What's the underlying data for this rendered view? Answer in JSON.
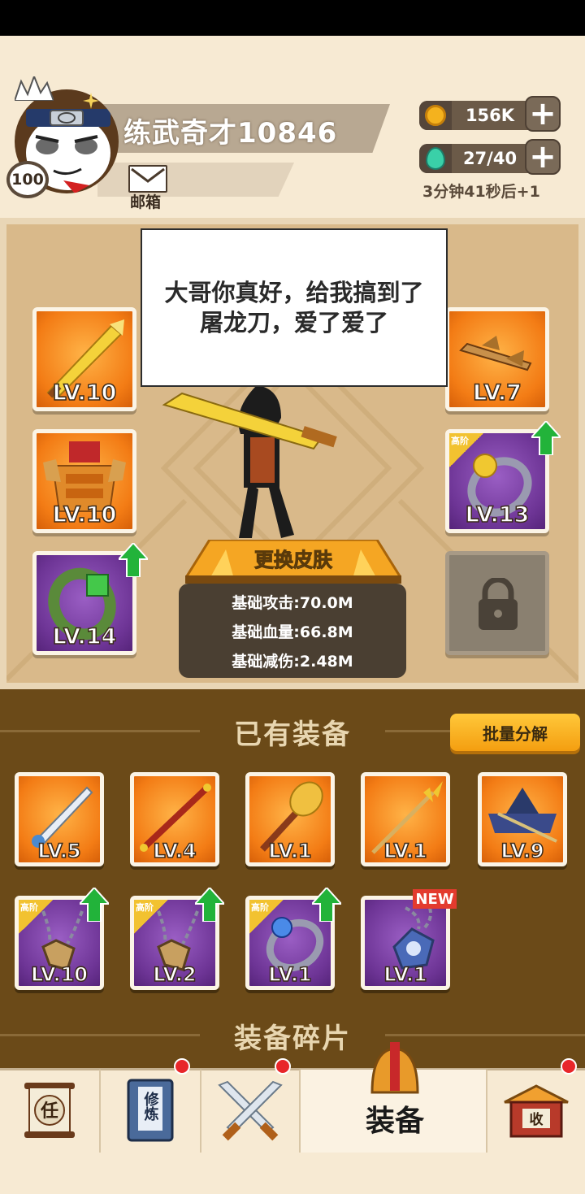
{
  "player": {
    "name": "练武奇才10846",
    "level": "100",
    "mail_label": "邮箱"
  },
  "resources": {
    "coins": "156K",
    "energy": "27/40",
    "timer": "3分钟41秒后+1"
  },
  "speech": "大哥你真好，给我搞到了屠龙刀，爱了爱了",
  "equipped": {
    "left": [
      {
        "label": "LV.10",
        "rarity": "orange",
        "icon": "golden-saber-icon"
      },
      {
        "label": "LV.10",
        "rarity": "orange",
        "icon": "armor-icon"
      },
      {
        "label": "LV.14",
        "rarity": "purple",
        "icon": "jade-bracelet-icon",
        "upgrade": true
      }
    ],
    "right": [
      {
        "label": "LV.7",
        "rarity": "orange",
        "icon": "dragon-hairpin-icon"
      },
      {
        "label": "LV.13",
        "rarity": "purple",
        "tier": "高阶",
        "icon": "pearl-ring-icon",
        "upgrade": true
      },
      {
        "label": "",
        "rarity": "locked",
        "icon": "padlock-icon"
      }
    ]
  },
  "skin_button": "更换皮肤",
  "stats": [
    "基础攻击:70.0M",
    "基础血量:66.8M",
    "基础减伤:2.48M"
  ],
  "inventory": {
    "title": "已有装备",
    "bulk_button": "批量分解",
    "items": [
      {
        "label": "LV.5",
        "rarity": "orange",
        "icon": "sword-icon"
      },
      {
        "label": "LV.4",
        "rarity": "orange",
        "icon": "staff-icon"
      },
      {
        "label": "LV.1",
        "rarity": "orange",
        "icon": "mace-icon"
      },
      {
        "label": "LV.1",
        "rarity": "orange",
        "icon": "spear-icon"
      },
      {
        "label": "LV.9",
        "rarity": "orange",
        "icon": "straw-hat-icon"
      },
      {
        "label": "LV.10",
        "rarity": "purple",
        "tier": "高阶",
        "icon": "amulet-icon",
        "upgrade": true
      },
      {
        "label": "LV.2",
        "rarity": "purple",
        "tier": "高阶",
        "icon": "amulet-icon",
        "upgrade": true
      },
      {
        "label": "LV.1",
        "rarity": "purple",
        "tier": "高阶",
        "icon": "gem-ring-icon",
        "upgrade": true
      },
      {
        "label": "LV.1",
        "rarity": "purple",
        "icon": "sapphire-pendant-icon",
        "badge": "NEW"
      }
    ]
  },
  "fragments_title": "装备碎片",
  "nav": {
    "task_glyph": "任",
    "train_glyph": "修炼",
    "equip_label": "装备",
    "collect_glyph": "收"
  },
  "colors": {
    "orange_rarity": "#f37c15",
    "purple_rarity": "#6e3596",
    "upgrade_arrow": "#22b33a",
    "new_badge": "#e33b2e"
  }
}
